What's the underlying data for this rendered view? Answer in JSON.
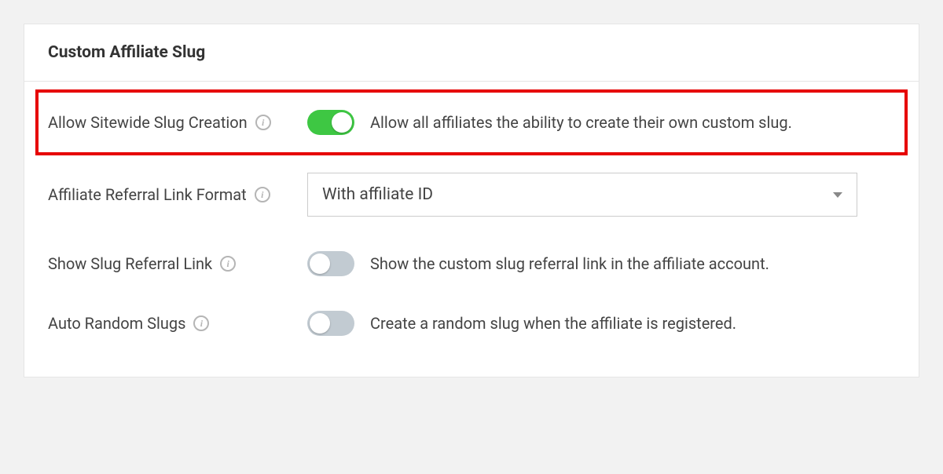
{
  "panel": {
    "title": "Custom Affiliate Slug"
  },
  "rows": {
    "allow_sitewide": {
      "label": "Allow Sitewide Slug Creation",
      "desc": "Allow all affiliates the ability to create their own custom slug."
    },
    "link_format": {
      "label": "Affiliate Referral Link Format",
      "selected": "With affiliate ID"
    },
    "show_slug": {
      "label": "Show Slug Referral Link",
      "desc": "Show the custom slug referral link in the affiliate account."
    },
    "auto_random": {
      "label": "Auto Random Slugs",
      "desc": "Create a random slug when the affiliate is registered."
    }
  }
}
